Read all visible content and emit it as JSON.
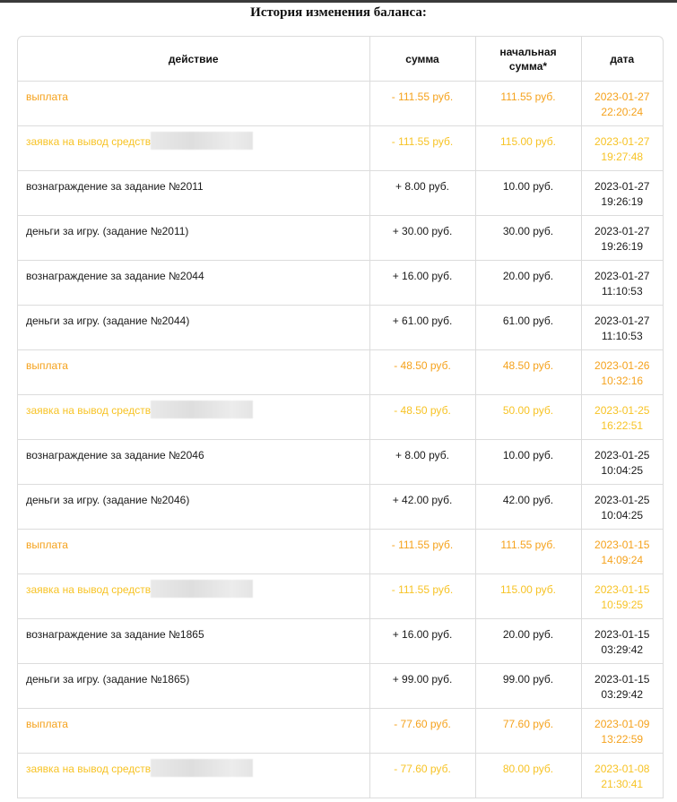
{
  "page": {
    "title": "История изменения баланса:"
  },
  "table": {
    "headers": {
      "action": "действие",
      "amount": "сумма",
      "start": "начальная сумма*",
      "date": "дата"
    },
    "rows": [
      {
        "kind": "payout",
        "action": "выплата",
        "amount": "- 111.55 руб.",
        "start": "111.55 руб.",
        "date": "2023-01-27",
        "time": "22:20:24"
      },
      {
        "kind": "request",
        "action": "заявка на вывод средств",
        "amount": "- 111.55 руб.",
        "start": "115.00 руб.",
        "date": "2023-01-27",
        "time": "19:27:48"
      },
      {
        "kind": "normal",
        "action": "вознаграждение за задание №2011",
        "amount": "+ 8.00 руб.",
        "start": "10.00 руб.",
        "date": "2023-01-27",
        "time": "19:26:19"
      },
      {
        "kind": "normal",
        "action": "деньги за игру. (задание №2011)",
        "amount": "+ 30.00 руб.",
        "start": "30.00 руб.",
        "date": "2023-01-27",
        "time": "19:26:19"
      },
      {
        "kind": "normal",
        "action": "вознаграждение за задание №2044",
        "amount": "+ 16.00 руб.",
        "start": "20.00 руб.",
        "date": "2023-01-27",
        "time": "11:10:53"
      },
      {
        "kind": "normal",
        "action": "деньги за игру. (задание №2044)",
        "amount": "+ 61.00 руб.",
        "start": "61.00 руб.",
        "date": "2023-01-27",
        "time": "11:10:53"
      },
      {
        "kind": "payout",
        "action": "выплата",
        "amount": "- 48.50 руб.",
        "start": "48.50 руб.",
        "date": "2023-01-26",
        "time": "10:32:16"
      },
      {
        "kind": "request",
        "action": "заявка на вывод средств",
        "amount": "- 48.50 руб.",
        "start": "50.00 руб.",
        "date": "2023-01-25",
        "time": "16:22:51"
      },
      {
        "kind": "normal",
        "action": "вознаграждение за задание №2046",
        "amount": "+ 8.00 руб.",
        "start": "10.00 руб.",
        "date": "2023-01-25",
        "time": "10:04:25"
      },
      {
        "kind": "normal",
        "action": "деньги за игру. (задание №2046)",
        "amount": "+ 42.00 руб.",
        "start": "42.00 руб.",
        "date": "2023-01-25",
        "time": "10:04:25"
      },
      {
        "kind": "payout",
        "action": "выплата",
        "amount": "- 111.55 руб.",
        "start": "111.55 руб.",
        "date": "2023-01-15",
        "time": "14:09:24"
      },
      {
        "kind": "request",
        "action": "заявка на вывод средств",
        "amount": "- 111.55 руб.",
        "start": "115.00 руб.",
        "date": "2023-01-15",
        "time": "10:59:25"
      },
      {
        "kind": "normal",
        "action": "вознаграждение за задание №1865",
        "amount": "+ 16.00 руб.",
        "start": "20.00 руб.",
        "date": "2023-01-15",
        "time": "03:29:42"
      },
      {
        "kind": "normal",
        "action": "деньги за игру. (задание №1865)",
        "amount": "+ 99.00 руб.",
        "start": "99.00 руб.",
        "date": "2023-01-15",
        "time": "03:29:42"
      },
      {
        "kind": "payout",
        "action": "выплата",
        "amount": "- 77.60 руб.",
        "start": "77.60 руб.",
        "date": "2023-01-09",
        "time": "13:22:59"
      },
      {
        "kind": "request",
        "action": "заявка на вывод средств",
        "amount": "- 77.60 руб.",
        "start": "80.00 руб.",
        "date": "2023-01-08",
        "time": "21:30:41"
      }
    ]
  },
  "colors": {
    "payout": "#f5a21c",
    "request": "#f7c325",
    "normal": "#1a1a1a",
    "border": "#dcdcdc"
  }
}
